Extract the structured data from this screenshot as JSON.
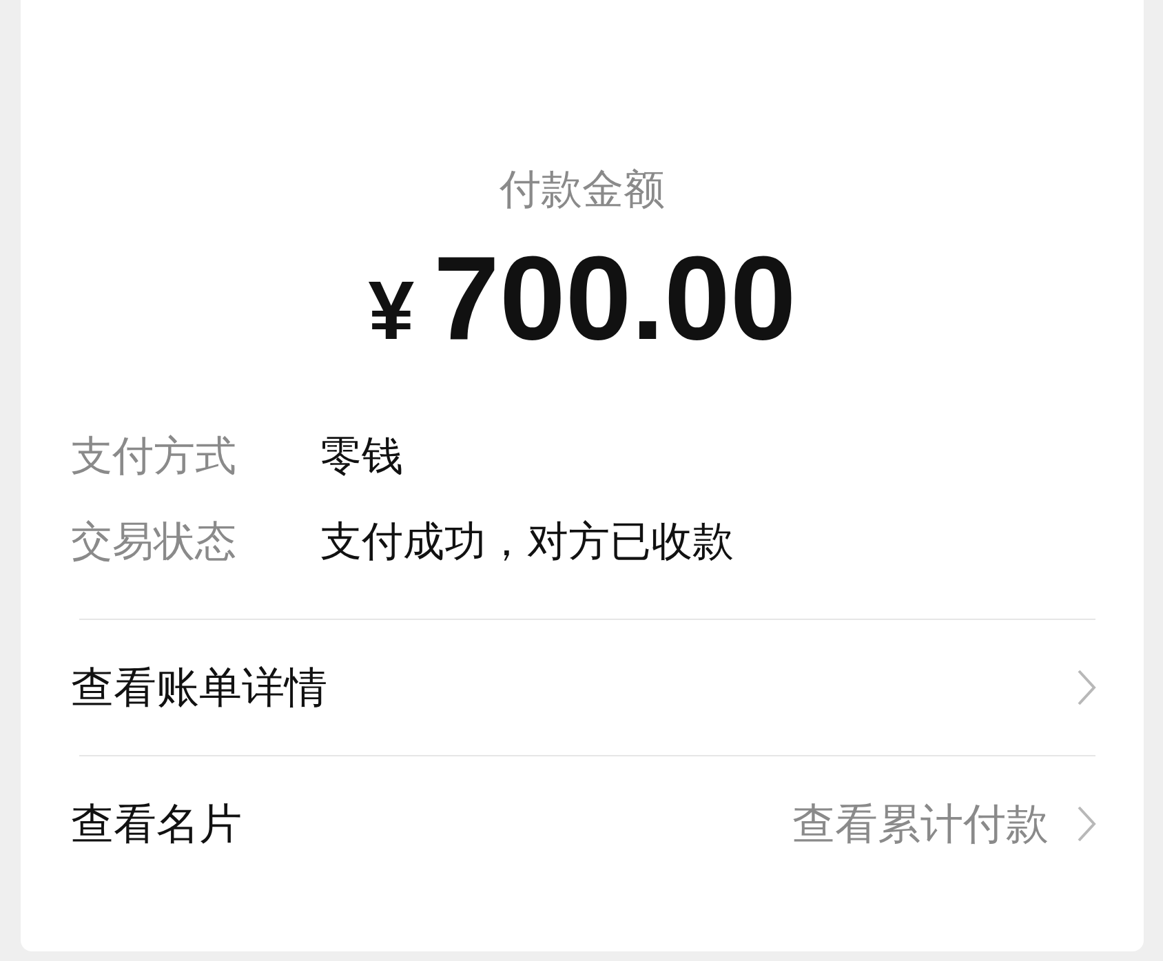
{
  "header": {
    "label": "付款金额",
    "currency": "¥",
    "amount": "700.00"
  },
  "details": [
    {
      "label": "支付方式",
      "value": "零钱"
    },
    {
      "label": "交易状态",
      "value": "支付成功，对方已收款"
    }
  ],
  "links": [
    {
      "label": "查看账单详情"
    },
    {
      "label": "查看名片",
      "hint": "查看累计付款"
    }
  ]
}
